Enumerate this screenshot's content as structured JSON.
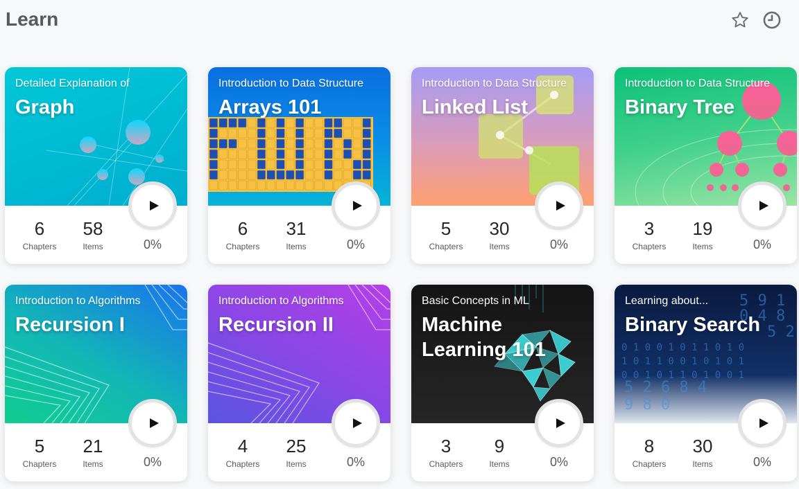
{
  "header": {
    "title": "Learn",
    "icons": [
      "star-icon",
      "clock-icon"
    ]
  },
  "colors": {
    "text_dark": "#262626",
    "text_muted": "#595959"
  },
  "cards": [
    {
      "subtitle": "Detailed Explanation of",
      "title": "Graph",
      "chapters": "6",
      "chapters_label": "Chapters",
      "items": "58",
      "items_label": "Items",
      "progress": "0%",
      "theme": [
        "#00c3d6",
        "#00b0d0"
      ]
    },
    {
      "subtitle": "Introduction to Data Structure",
      "title": "Arrays 101",
      "chapters": "6",
      "chapters_label": "Chapters",
      "items": "31",
      "items_label": "Items",
      "progress": "0%",
      "theme": [
        "#0d6fe0",
        "#06b6d8"
      ]
    },
    {
      "subtitle": "Introduction to Data Structure",
      "title": "Linked List",
      "chapters": "5",
      "chapters_label": "Chapters",
      "items": "30",
      "items_label": "Items",
      "progress": "0%",
      "theme": [
        "#a79cf4",
        "#ffa276"
      ]
    },
    {
      "subtitle": "Introduction to Data Structure",
      "title": "Binary Tree",
      "chapters": "3",
      "chapters_label": "Chapters",
      "items": "19",
      "items_label": "Items",
      "progress": "0%",
      "theme": [
        "#0fc27e",
        "#8ee39c"
      ]
    },
    {
      "subtitle": "Introduction to Algorithms",
      "title": "Recursion I",
      "chapters": "5",
      "chapters_label": "Chapters",
      "items": "21",
      "items_label": "Items",
      "progress": "0%",
      "theme": [
        "#12c99a",
        "#1a73ec"
      ]
    },
    {
      "subtitle": "Introduction to Algorithms",
      "title": "Recursion II",
      "chapters": "4",
      "chapters_label": "Chapters",
      "items": "25",
      "items_label": "Items",
      "progress": "0%",
      "theme": [
        "#6a4fe0",
        "#b43fe6"
      ]
    },
    {
      "subtitle": "Basic Concepts in ML",
      "title": "Machine Learning 101",
      "chapters": "3",
      "chapters_label": "Chapters",
      "items": "9",
      "items_label": "Items",
      "progress": "0%",
      "theme": [
        "#1a1a1a",
        "#2b2b2b"
      ]
    },
    {
      "subtitle": "Learning about...",
      "title": "Binary Search",
      "chapters": "8",
      "chapters_label": "Chapters",
      "items": "30",
      "items_label": "Items",
      "progress": "0%",
      "theme": [
        "#0b1c44",
        "#10265a"
      ]
    }
  ]
}
